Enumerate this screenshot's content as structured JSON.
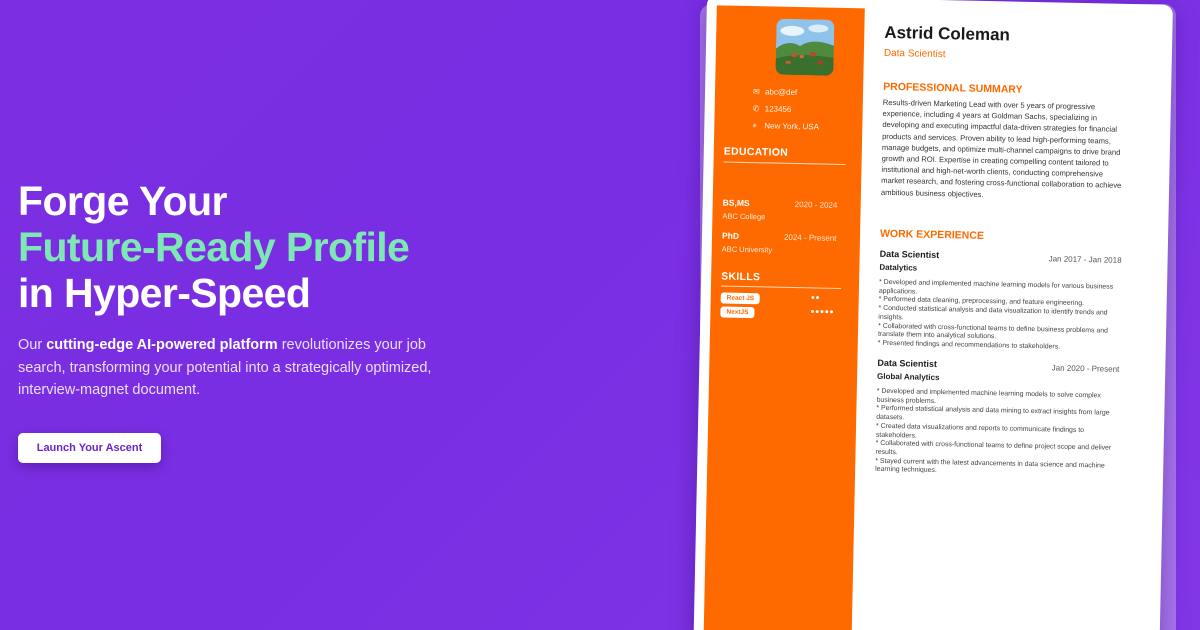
{
  "hero": {
    "headline_1": "Forge Your",
    "headline_2": "Future-Ready Profile",
    "headline_3": "in Hyper-Speed",
    "desc_pre": "Our ",
    "desc_bold": "cutting-edge AI-powered platform",
    "desc_post": " revolutionizes your job search, transforming your potential into a strategically optimized, interview-magnet document.",
    "cta_label": "Launch Your Ascent"
  },
  "colors": {
    "accent": "#7ee8b5",
    "brand": "#7b2fe0",
    "resume_accent": "#ff6a00"
  },
  "resume": {
    "name": "Astrid Coleman",
    "role": "Data Scientist",
    "contact": {
      "email": "abc@def",
      "phone": "123456",
      "location": "New York, USA"
    },
    "education_heading": "EDUCATION",
    "education": [
      {
        "degree": "BS,MS",
        "years": "2020 - 2024",
        "school": "ABC College"
      },
      {
        "degree": "PhD",
        "years": "2024 - Present",
        "school": "ABC University"
      }
    ],
    "skills_heading": "SKILLS",
    "skills": [
      {
        "name": "React JS",
        "level": "●●"
      },
      {
        "name": "NextJS",
        "level": "●●●●●"
      }
    ],
    "summary_heading": "PROFESSIONAL SUMMARY",
    "summary": "Results-driven Marketing Lead with over 5 years of progressive experience, including 4 years at Goldman Sachs, specializing in developing and executing impactful data-driven strategies for financial products and services. Proven ability to lead high-performing teams, manage budgets, and optimize multi-channel campaigns to drive brand growth and ROI. Expertise in creating compelling content tailored to institutional and high-net-worth clients, conducting comprehensive market research, and fostering cross-functional collaboration to achieve ambitious business objectives.",
    "work_heading": "WORK EXPERIENCE",
    "jobs": [
      {
        "title": "Data Scientist",
        "dates": "Jan 2017 - Jan 2018",
        "company": "Datalytics",
        "bullets": [
          "* Developed and implemented machine learning models for various business applications.",
          "* Performed data cleaning, preprocessing, and feature engineering.",
          "* Conducted statistical analysis and data visualization to identify trends and insights.",
          "* Collaborated with cross-functional teams to define business problems and translate them into analytical solutions.",
          "* Presented findings and recommendations to stakeholders."
        ]
      },
      {
        "title": "Data Scientist",
        "dates": "Jan 2020 - Present",
        "company": "Global Analytics",
        "bullets": [
          "* Developed and implemented machine learning models to solve complex business problems.",
          "* Performed statistical analysis and data mining to extract insights from large datasets.",
          "* Created data visualizations and reports to communicate findings to stakeholders.",
          "* Collaborated with cross-functional teams to define project scope and deliver results.",
          "* Stayed current with the latest advancements in data science and machine learning techniques."
        ]
      }
    ]
  }
}
